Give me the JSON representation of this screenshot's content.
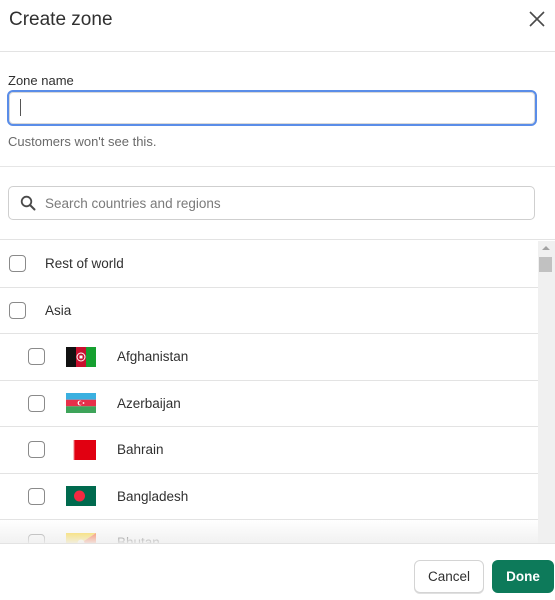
{
  "dialog": {
    "title": "Create zone",
    "close_icon": "close-icon"
  },
  "zone_name": {
    "label": "Zone name",
    "value": "",
    "placeholder": "",
    "help_text": "Customers won't see this."
  },
  "search": {
    "icon": "search-icon",
    "placeholder": "Search countries and regions",
    "value": ""
  },
  "list": {
    "groups": [
      {
        "label": "Rest of world",
        "checked": false
      },
      {
        "label": "Asia",
        "checked": false
      }
    ],
    "countries": [
      {
        "label": "Afghanistan",
        "flag": "afghanistan-flag-icon",
        "checked": false
      },
      {
        "label": "Azerbaijan",
        "flag": "azerbaijan-flag-icon",
        "checked": false
      },
      {
        "label": "Bahrain",
        "flag": "bahrain-flag-icon",
        "checked": false
      },
      {
        "label": "Bangladesh",
        "flag": "bangladesh-flag-icon",
        "checked": false
      },
      {
        "label": "Bhutan",
        "flag": "bhutan-flag-icon",
        "checked": false
      }
    ]
  },
  "footer": {
    "cancel_label": "Cancel",
    "done_label": "Done"
  },
  "colors": {
    "primary": "#0d7a5a",
    "focus_ring": "#5a8de8"
  }
}
